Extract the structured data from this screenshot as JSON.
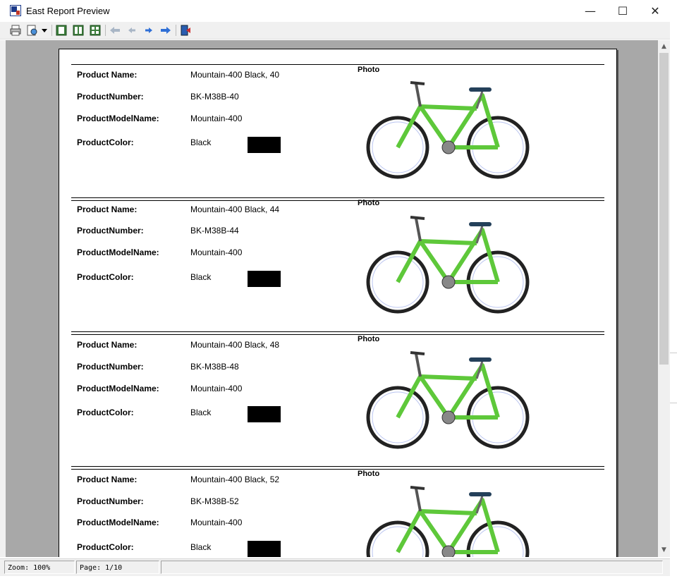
{
  "window": {
    "title": "East Report Preview",
    "minimize": "—",
    "maximize": "☐",
    "close": "✕"
  },
  "records": [
    {
      "name_label": "Product Name:",
      "name": "Mountain-400 Black, 40",
      "number_label": "ProductNumber:",
      "number": "BK-M38B-40",
      "model_label": "ProductModelName:",
      "model": "Mountain-400",
      "color_label": "ProductColor:",
      "color": "Black",
      "photo_label": "Photo"
    },
    {
      "name_label": "Product Name:",
      "name": "Mountain-400 Black, 44",
      "number_label": "ProductNumber:",
      "number": "BK-M38B-44",
      "model_label": "ProductModelName:",
      "model": "Mountain-400",
      "color_label": "ProductColor:",
      "color": "Black",
      "photo_label": "Photo"
    },
    {
      "name_label": "Product Name:",
      "name": "Mountain-400 Black, 48",
      "number_label": "ProductNumber:",
      "number": "BK-M38B-48",
      "model_label": "ProductModelName:",
      "model": "Mountain-400",
      "color_label": "ProductColor:",
      "color": "Black",
      "photo_label": "Photo"
    },
    {
      "name_label": "Product Name:",
      "name": "Mountain-400 Black, 52",
      "number_label": "ProductNumber:",
      "number": "BK-M38B-52",
      "model_label": "ProductModelName:",
      "model": "Mountain-400",
      "color_label": "ProductColor:",
      "color": "Black",
      "photo_label": "Photo"
    }
  ],
  "status": {
    "zoom": "Zoom:  100%",
    "page": "Page:  1/10"
  },
  "colors": {
    "swatch": "#000000",
    "bike_frame": "#5ec83a",
    "viewport_bg": "#a8a8a8"
  },
  "icons": [
    "print-icon",
    "page-setup-icon",
    "dropdown-arrow-icon",
    "single-page-icon",
    "two-page-icon",
    "multi-page-icon",
    "first-page-icon",
    "previous-page-icon",
    "next-page-icon",
    "last-page-icon",
    "exit-icon"
  ]
}
